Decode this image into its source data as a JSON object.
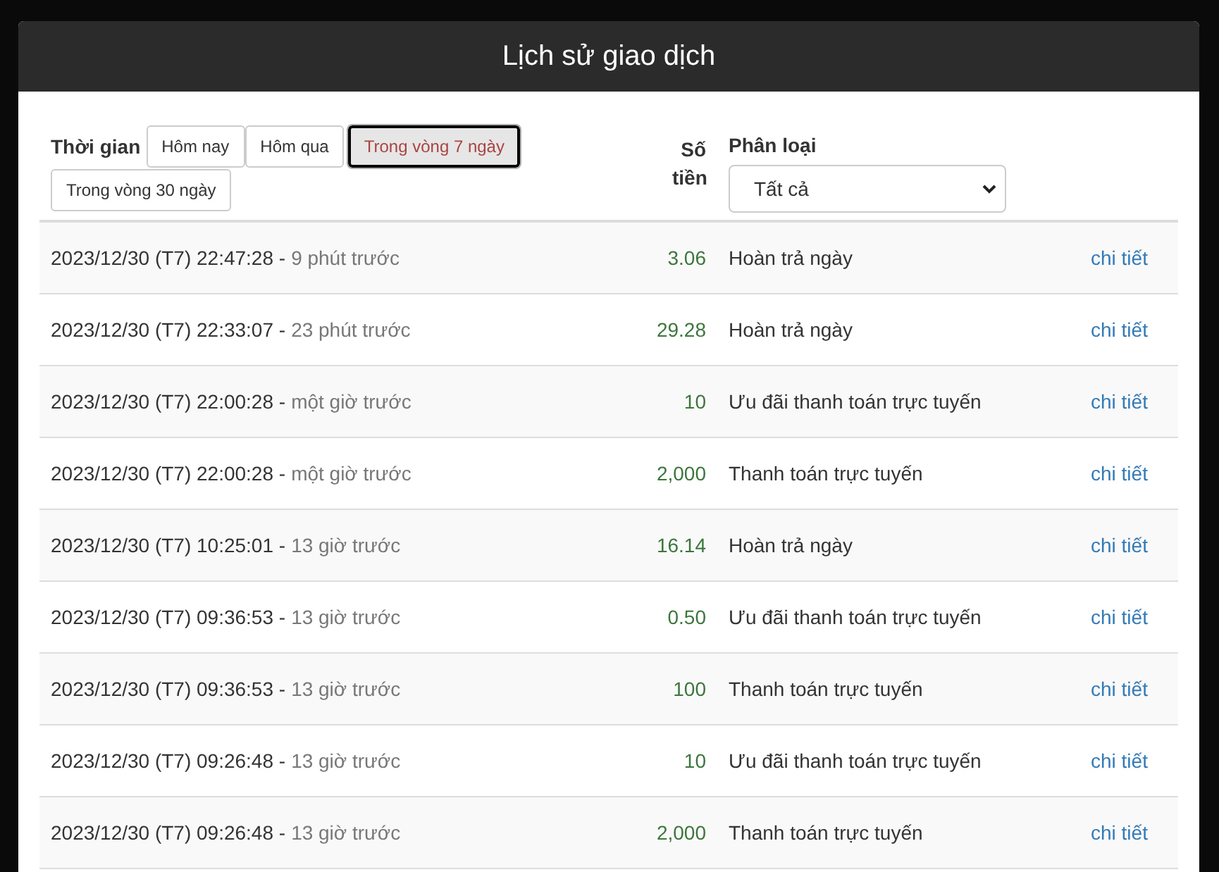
{
  "title": "Lịch sử giao dịch",
  "filters": {
    "label": "Thời gian",
    "buttons": [
      {
        "label": "Hôm nay",
        "selected": false
      },
      {
        "label": "Hôm qua",
        "selected": false
      },
      {
        "label": "Trong vòng 7 ngày",
        "selected": true
      },
      {
        "label": "Trong vòng 30 ngày",
        "selected": false
      }
    ]
  },
  "columns": {
    "amount": "Số tiền",
    "type": "Phân loại",
    "type_select": "Tất cả"
  },
  "rows": [
    {
      "time": "2023/12/30 (T7) 22:47:28 -",
      "ago": "9 phút trước",
      "amount": "3.06",
      "type": "Hoàn trả ngày",
      "link": "chi tiết"
    },
    {
      "time": "2023/12/30 (T7) 22:33:07 -",
      "ago": "23 phút trước",
      "amount": "29.28",
      "type": "Hoàn trả ngày",
      "link": "chi tiết"
    },
    {
      "time": "2023/12/30 (T7) 22:00:28 -",
      "ago": "một giờ trước",
      "amount": "10",
      "type": "Ưu đãi thanh toán trực tuyến",
      "link": "chi tiết"
    },
    {
      "time": "2023/12/30 (T7) 22:00:28 -",
      "ago": "một giờ trước",
      "amount": "2,000",
      "type": "Thanh toán trực tuyến",
      "link": "chi tiết"
    },
    {
      "time": "2023/12/30 (T7) 10:25:01 -",
      "ago": "13 giờ trước",
      "amount": "16.14",
      "type": "Hoàn trả ngày",
      "link": "chi tiết"
    },
    {
      "time": "2023/12/30 (T7) 09:36:53 -",
      "ago": "13 giờ trước",
      "amount": "0.50",
      "type": "Ưu đãi thanh toán trực tuyến",
      "link": "chi tiết"
    },
    {
      "time": "2023/12/30 (T7) 09:36:53 -",
      "ago": "13 giờ trước",
      "amount": "100",
      "type": "Thanh toán trực tuyến",
      "link": "chi tiết"
    },
    {
      "time": "2023/12/30 (T7) 09:26:48 -",
      "ago": "13 giờ trước",
      "amount": "10",
      "type": "Ưu đãi thanh toán trực tuyến",
      "link": "chi tiết"
    },
    {
      "time": "2023/12/30 (T7) 09:26:48 -",
      "ago": "13 giờ trước",
      "amount": "2,000",
      "type": "Thanh toán trực tuyến",
      "link": "chi tiết"
    }
  ]
}
